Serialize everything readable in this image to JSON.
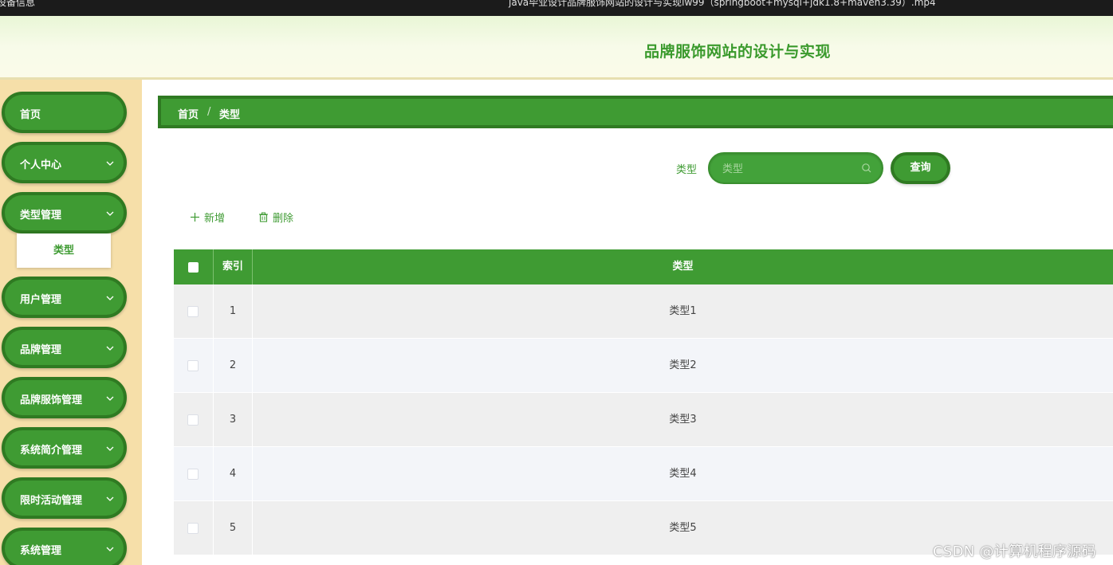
{
  "window": {
    "left_title": "设备信息",
    "center_title": "java毕业设计品牌服饰网站的设计与实现lw99（springboot+mysql+jdk1.8+maven3.39）.mp4"
  },
  "header": {
    "title": "品牌服饰网站的设计与实现"
  },
  "sidebar": {
    "items": [
      {
        "label": "首页",
        "has_chevron": false
      },
      {
        "label": "个人中心",
        "has_chevron": true
      },
      {
        "label": "类型管理",
        "has_chevron": true
      },
      {
        "label": "用户管理",
        "has_chevron": true
      },
      {
        "label": "品牌管理",
        "has_chevron": true
      },
      {
        "label": "品牌服饰管理",
        "has_chevron": true
      },
      {
        "label": "系统简介管理",
        "has_chevron": true
      },
      {
        "label": "限时活动管理",
        "has_chevron": true
      },
      {
        "label": "系统管理",
        "has_chevron": true
      }
    ],
    "submenu": {
      "label": "类型"
    }
  },
  "breadcrumb": {
    "home": "首页",
    "separator": "/",
    "current": "类型"
  },
  "search": {
    "label": "类型",
    "placeholder": "类型",
    "button": "查询"
  },
  "actions": {
    "add": "新增",
    "delete": "删除"
  },
  "table": {
    "columns": [
      "索引",
      "类型"
    ],
    "rows": [
      {
        "index": "1",
        "type": "类型1"
      },
      {
        "index": "2",
        "type": "类型2"
      },
      {
        "index": "3",
        "type": "类型3"
      },
      {
        "index": "4",
        "type": "类型4"
      },
      {
        "index": "5",
        "type": "类型5"
      }
    ]
  },
  "watermark": "CSDN @计算机程序源码",
  "colors": {
    "primary_green": "#3f9b33",
    "dark_green": "#2f7a22",
    "sidebar_bg": "#f6dfa9"
  }
}
